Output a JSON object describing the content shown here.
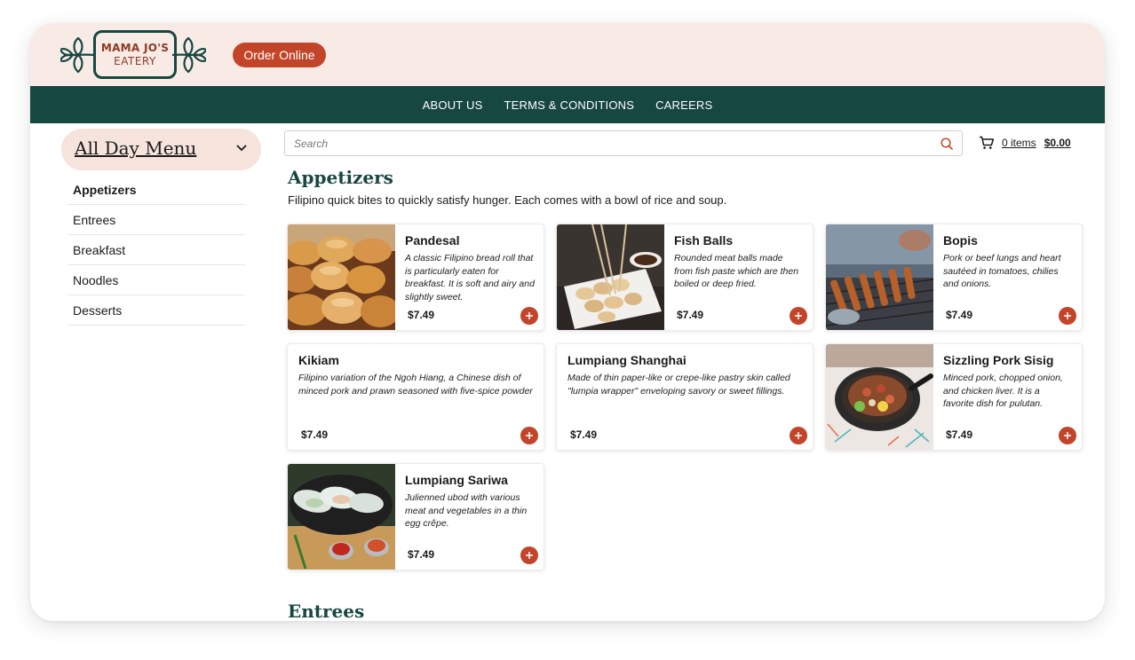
{
  "brand": {
    "line1": "MAMA JO'S",
    "line2": "EATERY"
  },
  "header": {
    "order_button": "Order Online"
  },
  "nav": {
    "items": [
      "ABOUT US",
      "TERMS & CONDITIONS",
      "CAREERS"
    ]
  },
  "sidebar": {
    "menu_title": "All Day Menu",
    "items": [
      {
        "label": "Appetizers",
        "active": true
      },
      {
        "label": "Entrees"
      },
      {
        "label": "Breakfast"
      },
      {
        "label": "Noodles"
      },
      {
        "label": "Desserts"
      }
    ]
  },
  "search": {
    "placeholder": "Search",
    "icon": "search-icon"
  },
  "cart": {
    "count": "0 items",
    "total": "$0.00",
    "icon": "cart-icon"
  },
  "sections": [
    {
      "title": "Appetizers",
      "description": "Filipino quick bites to quickly satisfy hunger. Each comes with a bowl of rice and soup.",
      "items": [
        {
          "name": "Pandesal",
          "description": "A classic Filipino bread roll that is particularly eaten for breakfast. It is soft and airy and slightly sweet.",
          "price": "$7.49",
          "image": "bread-rolls-photo"
        },
        {
          "name": "Fish Balls",
          "description": "Rounded meat balls made from fish paste which are then boiled or deep fried.",
          "price": "$7.49",
          "image": "fish-balls-photo"
        },
        {
          "name": "Bopis",
          "description": "Pork or beef lungs and heart sautéed in tomatoes, chilies and onions.",
          "price": "$7.49",
          "image": "grilled-skewers-photo"
        },
        {
          "name": "Kikiam",
          "description": "Filipino variation of the Ngoh Hiang, a Chinese dish of minced pork and prawn seasoned with five-spice powder",
          "price": "$7.49"
        },
        {
          "name": "Lumpiang Shanghai",
          "description": "Made of thin paper-like or crepe-like pastry skin called \"lumpia wrapper\" enveloping savory or sweet fillings.",
          "price": "$7.49"
        },
        {
          "name": "Sizzling Pork Sisig",
          "description": "Minced pork, chopped onion, and chicken liver. It is a favorite dish for pulutan.",
          "price": "$7.49",
          "image": "sizzling-sisig-photo"
        },
        {
          "name": "Lumpiang Sariwa",
          "description": "Julienned ubod with various meat and vegetables in a thin egg crêpe.",
          "price": "$7.49",
          "image": "fresh-spring-rolls-photo"
        }
      ]
    },
    {
      "title": "Entrees"
    }
  ],
  "colors": {
    "accent": "#c2452a",
    "brand_green": "#174741",
    "header_bg": "#f8ebe6",
    "menu_pill": "#f5e3dc"
  }
}
